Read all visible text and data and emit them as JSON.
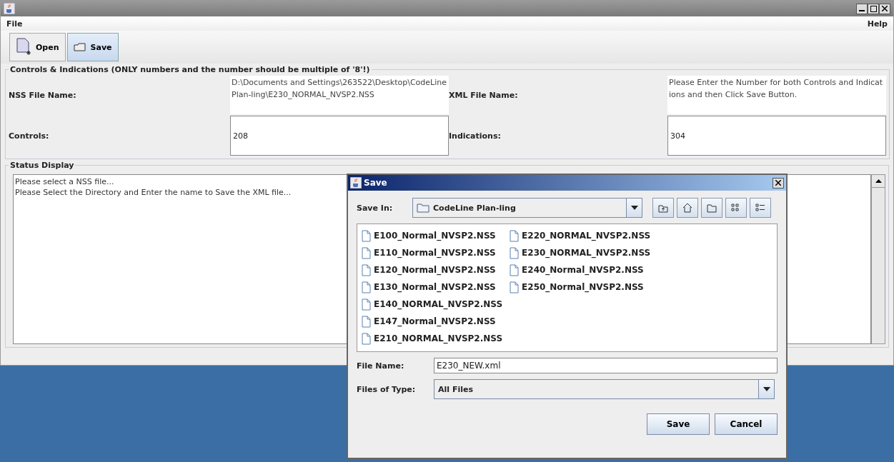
{
  "menu": {
    "left": "File",
    "right": "Help"
  },
  "toolbar": [
    {
      "kind": "open",
      "label": "Open",
      "selected": false
    },
    {
      "kind": "save",
      "label": "Save",
      "selected": true
    }
  ],
  "controls_panel": {
    "title": "Controls & Indications (ONLY numbers and the number should be multiple of '8'!)",
    "nss_label": "NSS File Name:",
    "nss_value": "D:\\Documents and Settings\\263522\\Desktop\\CodeLine Plan-ling\\E230_NORMAL_NVSP2.NSS",
    "xml_label": "XML File Name:",
    "xml_value": "Please Enter the Number for both Controls and Indications and then Click Save Button.",
    "controls_label": "Controls:",
    "controls_value": "208",
    "indications_label": "Indications:",
    "indications_value": "304"
  },
  "status_panel": {
    "title": "Status Display",
    "lines": [
      "Please select a NSS file...",
      "Please Select the Directory and Enter the name to Save the XML file..."
    ]
  },
  "dialog": {
    "title": "Save",
    "save_in_label": "Save In:",
    "save_in_value": "CodeLine Plan-ling",
    "files": [
      "E100_Normal_NVSP2.NSS",
      "E110_Normal_NVSP2.NSS",
      "E120_Normal_NVSP2.NSS",
      "E130_Normal_NVSP2.NSS",
      "E140_NORMAL_NVSP2.NSS",
      "E147_Normal_NVSP2.NSS",
      "E210_NORMAL_NVSP2.NSS",
      "E220_NORMAL_NVSP2.NSS",
      "E230_NORMAL_NVSP2.NSS",
      "E240_Normal_NVSP2.NSS",
      "E250_Normal_NVSP2.NSS"
    ],
    "file_name_label": "File Name:",
    "file_name_value": "E230_NEW.xml",
    "type_label": "Files of Type:",
    "type_value": "All Files",
    "buttons": [
      "Save",
      "Cancel"
    ]
  }
}
